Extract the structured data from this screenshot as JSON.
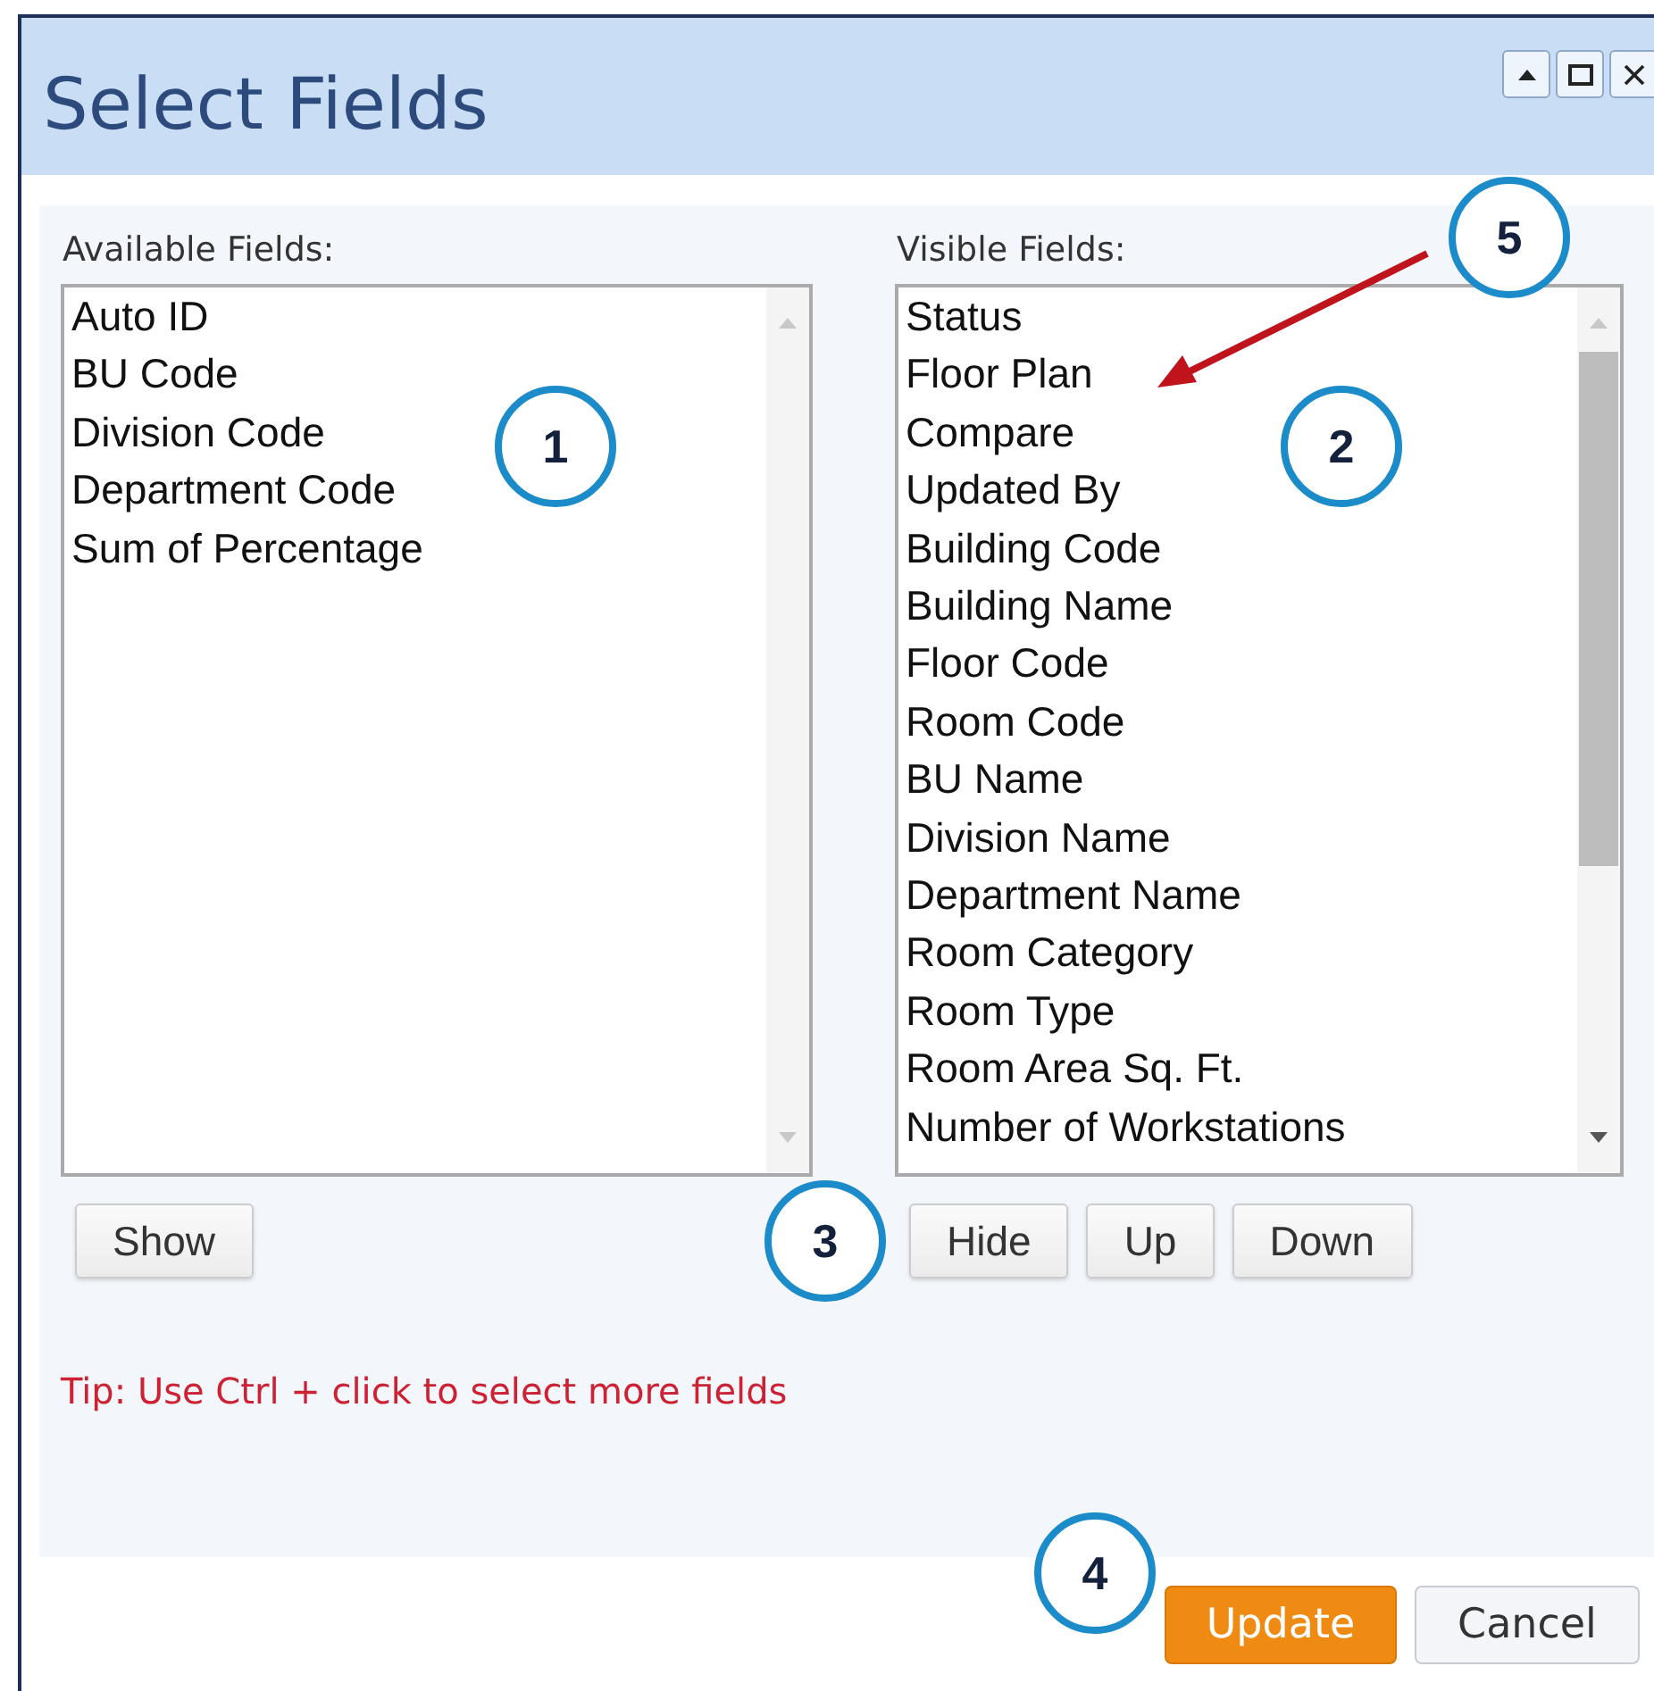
{
  "window": {
    "title": "Select Fields"
  },
  "available": {
    "label": "Available Fields:",
    "items": [
      "Auto ID",
      "BU Code",
      "Division Code",
      "Department Code",
      "Sum of Percentage"
    ]
  },
  "visible": {
    "label": "Visible Fields:",
    "items": [
      "Status",
      "Floor Plan",
      "Compare",
      "Updated By",
      "Building Code",
      "Building Name",
      "Floor Code",
      "Room Code",
      "BU Name",
      "Division Name",
      "Department Name",
      "Room Category",
      "Room Type",
      "Room Area Sq. Ft.",
      "Number of Workstations"
    ]
  },
  "show_button": "Show",
  "visible_buttons": [
    "Hide",
    "Up",
    "Down"
  ],
  "tip": "Tip: Use Ctrl + click to select more fields",
  "footer_buttons": [
    {
      "label": "Update",
      "kind": "primary"
    },
    {
      "label": "Cancel",
      "kind": "secondary"
    }
  ],
  "callouts": [
    {
      "label": "1"
    },
    {
      "label": "2"
    },
    {
      "label": "3"
    },
    {
      "label": "4"
    },
    {
      "label": "5"
    }
  ]
}
